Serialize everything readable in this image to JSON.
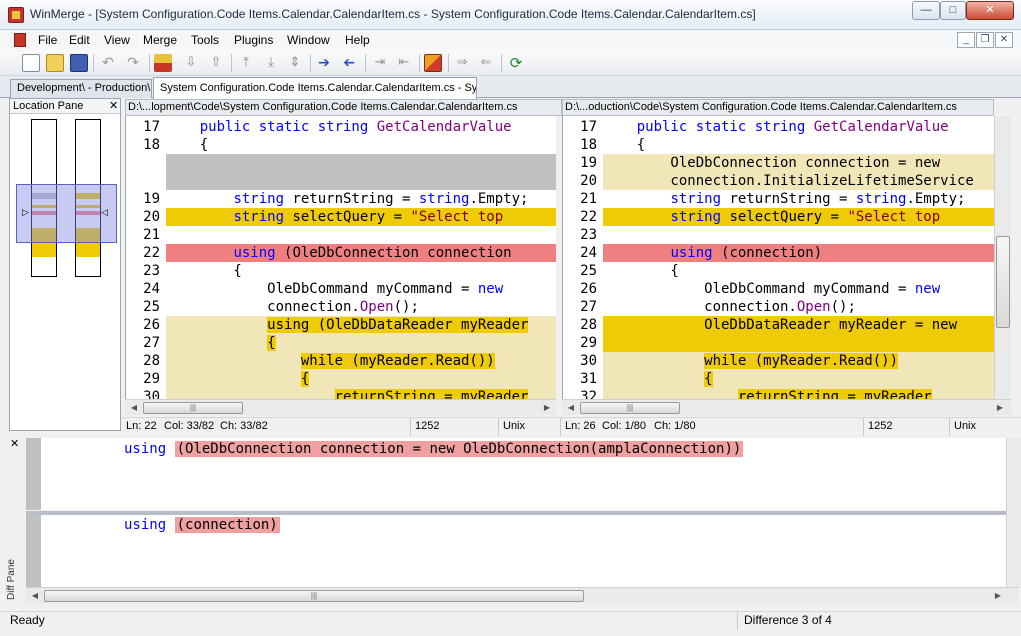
{
  "window": {
    "title": "WinMerge - [System Configuration.Code Items.Calendar.CalendarItem.cs - System Configuration.Code Items.Calendar.CalendarItem.cs]",
    "minimize": "—",
    "maximize": "□",
    "close": "✕"
  },
  "menu": [
    "File",
    "Edit",
    "View",
    "Merge",
    "Tools",
    "Plugins",
    "Window",
    "Help"
  ],
  "mdi": {
    "minimize": "_",
    "restore": "❐",
    "close": "✕"
  },
  "tabs": [
    {
      "label": "Development\\ - Production\\"
    },
    {
      "label": "System Configuration.Code Items.Calendar.CalendarItem.cs - Sy..."
    }
  ],
  "location_pane": {
    "title": "Location Pane",
    "close": "✕"
  },
  "left": {
    "path": "D:\\...lopment\\Code\\System Configuration.Code Items.Calendar.CalendarItem.cs",
    "status": {
      "ln": "Ln: 22",
      "col": "Col: 33/82",
      "ch": "Ch: 33/82",
      "codepage": "1252",
      "eol": "Unix"
    },
    "lines": [
      {
        "n": "17",
        "bg": "",
        "segs": [
          {
            "t": "    "
          },
          {
            "t": "public static string ",
            "c": "kw"
          },
          {
            "t": "GetCalendarValue",
            "c": "fn"
          }
        ]
      },
      {
        "n": "18",
        "bg": "",
        "segs": [
          {
            "t": "    {"
          }
        ]
      },
      {
        "n": "",
        "bg": "hl-gray",
        "segs": []
      },
      {
        "n": "",
        "bg": "hl-gray",
        "segs": []
      },
      {
        "n": "19",
        "bg": "",
        "segs": [
          {
            "t": "        "
          },
          {
            "t": "string",
            "c": "kw"
          },
          {
            "t": " returnString = "
          },
          {
            "t": "string",
            "c": "kw"
          },
          {
            "t": ".Empty;"
          }
        ]
      },
      {
        "n": "20",
        "bg": "hl-yellow",
        "segs": [
          {
            "t": "        "
          },
          {
            "t": "string",
            "c": "kw"
          },
          {
            "t": " selectQuery = "
          },
          {
            "t": "\"Select top",
            "c": "str"
          }
        ]
      },
      {
        "n": "21",
        "bg": "",
        "segs": []
      },
      {
        "n": "22",
        "bg": "hl-red",
        "segs": [
          {
            "t": "        "
          },
          {
            "t": "using",
            "c": "kw"
          },
          {
            "t": " (OleDbConnection connection"
          }
        ]
      },
      {
        "n": "23",
        "bg": "",
        "segs": [
          {
            "t": "        {"
          }
        ]
      },
      {
        "n": "24",
        "bg": "",
        "segs": [
          {
            "t": "            OleDbCommand myCommand = "
          },
          {
            "t": "new",
            "c": "kw"
          }
        ]
      },
      {
        "n": "25",
        "bg": "",
        "segs": [
          {
            "t": "            connection."
          },
          {
            "t": "Open",
            "c": "fn"
          },
          {
            "t": "();"
          }
        ]
      },
      {
        "n": "26",
        "bg": "hl-pale",
        "segs": [
          {
            "t": "            "
          },
          {
            "t": "using (OleDbDataReader myReader",
            "c": "yl"
          }
        ]
      },
      {
        "n": "27",
        "bg": "hl-pale",
        "segs": [
          {
            "t": "            "
          },
          {
            "t": "{",
            "c": "yl"
          }
        ]
      },
      {
        "n": "28",
        "bg": "hl-pale",
        "segs": [
          {
            "t": "                "
          },
          {
            "t": "while (myReader.Read())",
            "c": "yl"
          }
        ]
      },
      {
        "n": "29",
        "bg": "hl-pale",
        "segs": [
          {
            "t": "                "
          },
          {
            "t": "{",
            "c": "yl"
          }
        ]
      },
      {
        "n": "30",
        "bg": "hl-pale",
        "segs": [
          {
            "t": "                    "
          },
          {
            "t": "returnString = myReader",
            "c": "yl"
          }
        ]
      }
    ]
  },
  "right": {
    "path": "D:\\...oduction\\Code\\System Configuration.Code Items.Calendar.CalendarItem.cs",
    "status": {
      "ln": "Ln: 26",
      "col": "Col: 1/80",
      "ch": "Ch: 1/80",
      "codepage": "1252",
      "eol": "Unix"
    },
    "lines": [
      {
        "n": "17",
        "bg": "",
        "segs": [
          {
            "t": "    "
          },
          {
            "t": "public static string ",
            "c": "kw"
          },
          {
            "t": "GetCalendarValue",
            "c": "fn"
          }
        ]
      },
      {
        "n": "18",
        "bg": "",
        "segs": [
          {
            "t": "    {"
          }
        ]
      },
      {
        "n": "19",
        "bg": "hl-pale",
        "segs": [
          {
            "t": "        OleDbConnection connection = new"
          }
        ]
      },
      {
        "n": "20",
        "bg": "hl-pale",
        "segs": [
          {
            "t": "        connection.InitializeLifetimeService"
          }
        ]
      },
      {
        "n": "21",
        "bg": "",
        "segs": [
          {
            "t": "        "
          },
          {
            "t": "string",
            "c": "kw"
          },
          {
            "t": " returnString = "
          },
          {
            "t": "string",
            "c": "kw"
          },
          {
            "t": ".Empty;"
          }
        ]
      },
      {
        "n": "22",
        "bg": "hl-yellow",
        "segs": [
          {
            "t": "        "
          },
          {
            "t": "string",
            "c": "kw"
          },
          {
            "t": " selectQuery = "
          },
          {
            "t": "\"Select top",
            "c": "str"
          }
        ]
      },
      {
        "n": "23",
        "bg": "",
        "segs": []
      },
      {
        "n": "24",
        "bg": "hl-red",
        "segs": [
          {
            "t": "        "
          },
          {
            "t": "using",
            "c": "kw"
          },
          {
            "t": " (connection)"
          }
        ]
      },
      {
        "n": "25",
        "bg": "",
        "segs": [
          {
            "t": "        {"
          }
        ]
      },
      {
        "n": "26",
        "bg": "",
        "segs": [
          {
            "t": "            OleDbCommand myCommand = "
          },
          {
            "t": "new",
            "c": "kw"
          }
        ]
      },
      {
        "n": "27",
        "bg": "",
        "segs": [
          {
            "t": "            connection."
          },
          {
            "t": "Open",
            "c": "fn"
          },
          {
            "t": "();"
          }
        ]
      },
      {
        "n": "28",
        "bg": "hl-yellow",
        "segs": [
          {
            "t": "            OleDbDataReader myReader = new"
          }
        ]
      },
      {
        "n": "29",
        "bg": "hl-yellow",
        "segs": []
      },
      {
        "n": "30",
        "bg": "hl-pale",
        "segs": [
          {
            "t": "            "
          },
          {
            "t": "while (myReader.Read())",
            "c": "yl"
          }
        ]
      },
      {
        "n": "31",
        "bg": "hl-pale",
        "segs": [
          {
            "t": "            "
          },
          {
            "t": "{",
            "c": "yl"
          }
        ]
      },
      {
        "n": "32",
        "bg": "hl-pale",
        "segs": [
          {
            "t": "                "
          },
          {
            "t": "returnString = myReader",
            "c": "yl"
          }
        ]
      }
    ]
  },
  "diff_pane": {
    "label": "Diff Pane",
    "close": "✕",
    "top_line": {
      "kw": "using",
      "rest": "(OleDbConnection connection = new OleDbConnection(amplaConnection))"
    },
    "bottom_line": {
      "kw": "using",
      "rest": "(connection)"
    }
  },
  "status": {
    "ready": "Ready",
    "difference": "Difference 3 of 4"
  },
  "colors": {
    "yellow": "#efcb05",
    "pale": "#f0e6b8",
    "red": "#f08080",
    "gray": "#c0c0c0"
  }
}
